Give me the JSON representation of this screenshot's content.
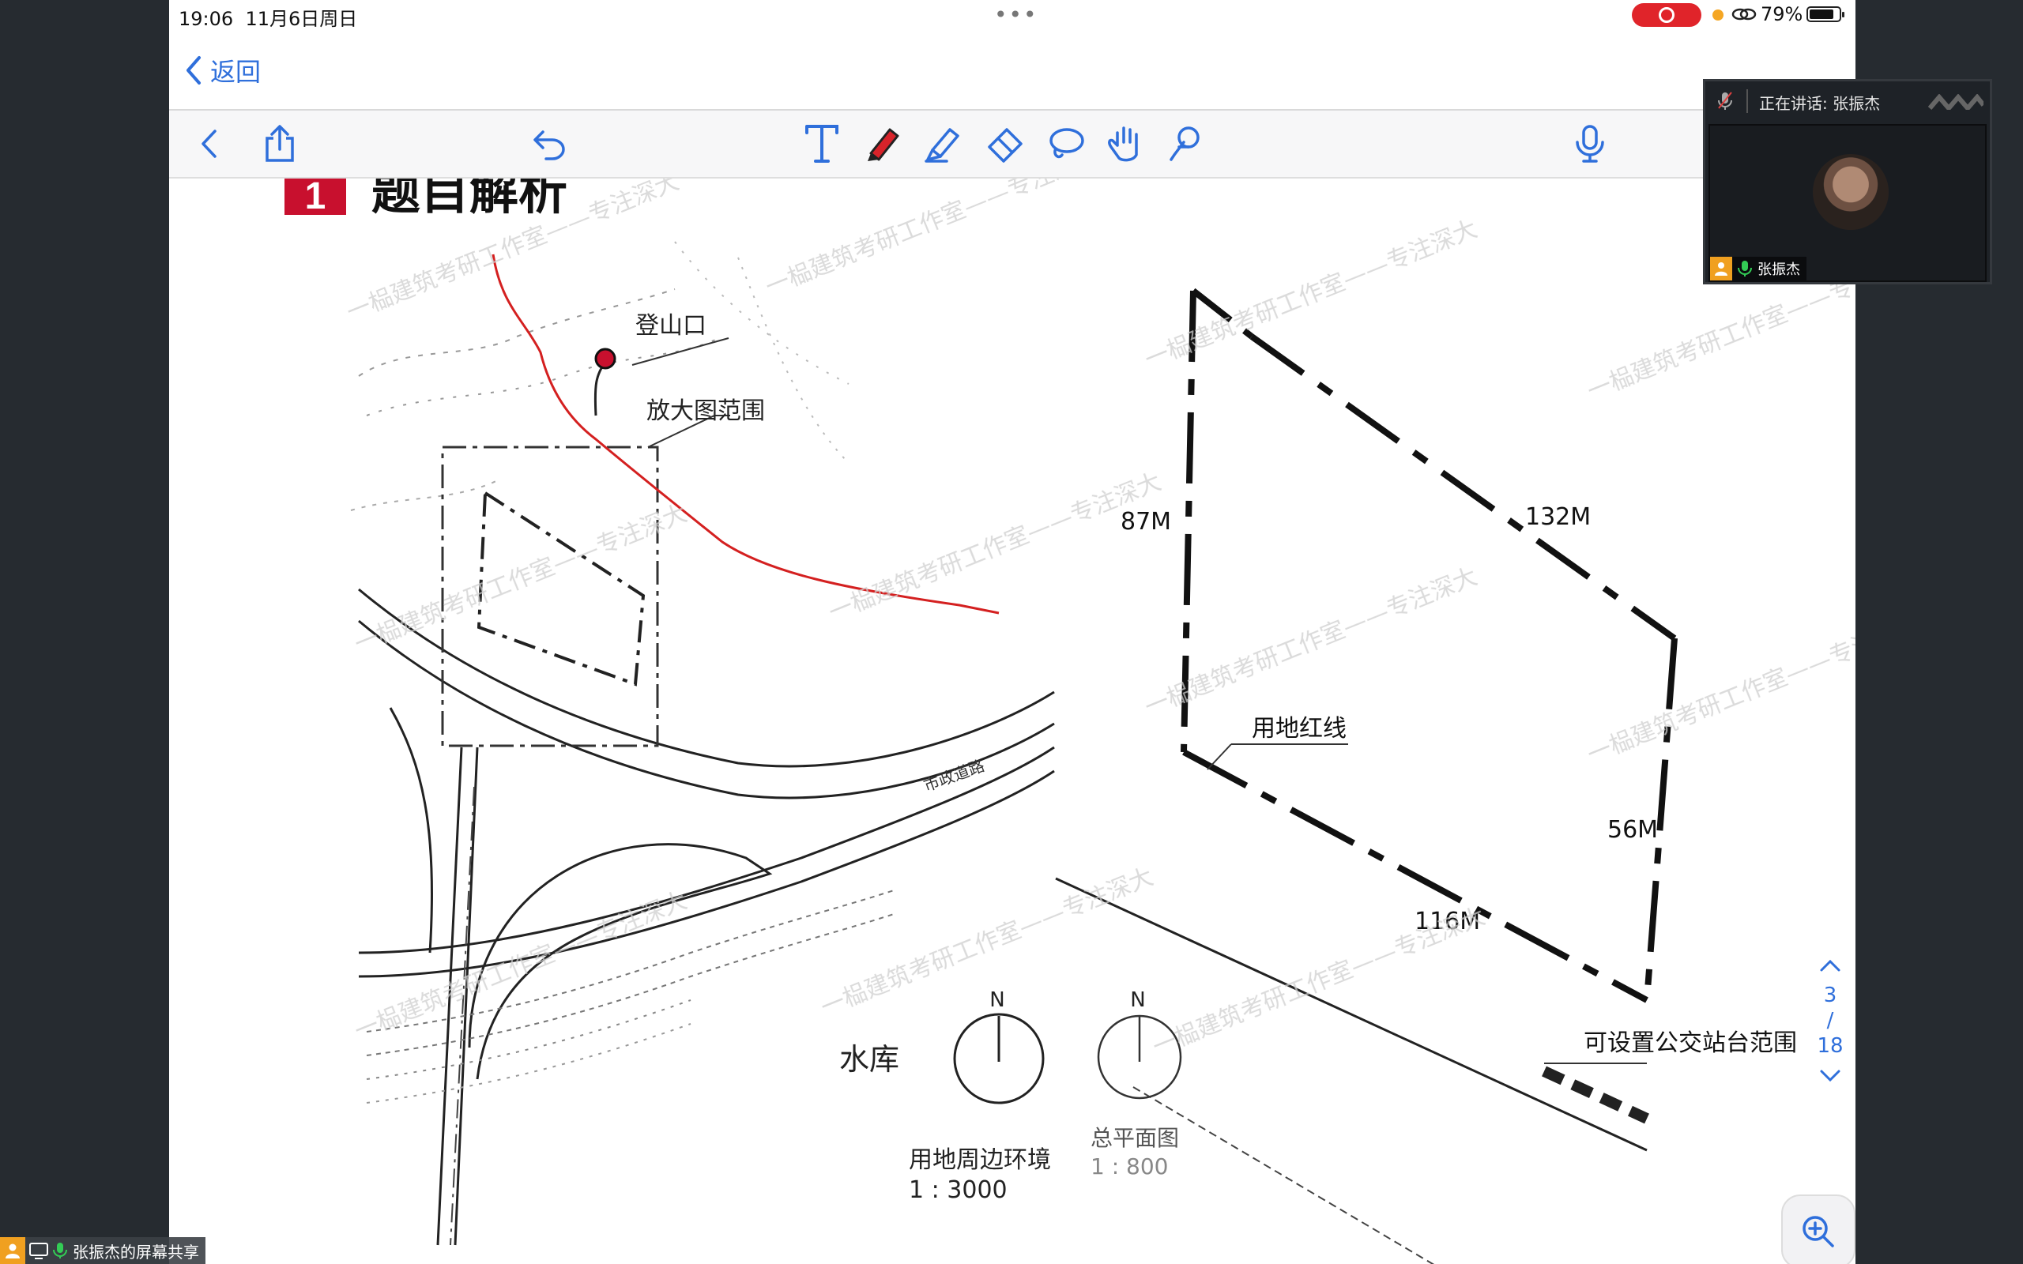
{
  "status_bar": {
    "time": "19:06",
    "date": "11月6日周日",
    "battery": "79%"
  },
  "nav": {
    "back_label": "返回"
  },
  "toolbar": {
    "tools": [
      "back",
      "share",
      "undo",
      "text",
      "pen",
      "highlighter",
      "eraser",
      "lasso",
      "hand",
      "touch",
      "microphone",
      "add"
    ]
  },
  "slide": {
    "section_number": "1",
    "heading": "题目解析",
    "watermark": "一榀建筑考研工作室——专注深大",
    "left_map": {
      "label_trailhead": "登山口",
      "label_enlarge": "放大图范围",
      "label_road": "市政道路",
      "label_reservoir": "水库",
      "north": "N",
      "caption": "用地周边环境",
      "scale": "1 : 3000"
    },
    "right_site": {
      "side_87": "87M",
      "side_132": "132M",
      "side_56": "56M",
      "side_116": "116M",
      "label_redline": "用地红线",
      "label_bus": "可设置公交站台范围",
      "north": "N",
      "caption": "总平面图",
      "scale": "1 : 800"
    }
  },
  "pager": {
    "current": "3",
    "divider": "/",
    "total": "18"
  },
  "video_panel": {
    "speaking": "正在讲话: 张振杰",
    "name": "张振杰"
  },
  "share_bar": {
    "label": "张振杰的屏幕共享"
  },
  "colors": {
    "accent": "#2f6fdb",
    "red_mark": "#c8102e",
    "record": "#e0242a"
  }
}
